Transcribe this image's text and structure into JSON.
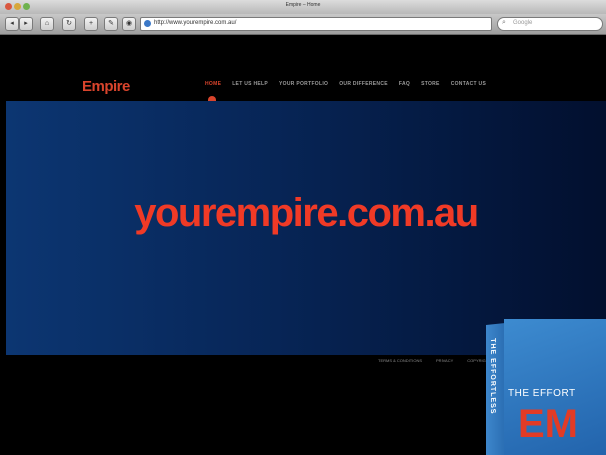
{
  "window": {
    "title": "Empire – Home",
    "controls": [
      "close",
      "minimize",
      "zoom"
    ]
  },
  "toolbar": {
    "back_icon": "back-arrow-icon",
    "forward_icon": "forward-arrow-icon",
    "buttons": [
      "home-icon",
      "reload-icon",
      "add-bookmark-icon",
      "edit-icon",
      "view-icon"
    ],
    "url": "http://www.yourempire.com.au/",
    "search_placeholder": "Google"
  },
  "site": {
    "logo": "Empire",
    "logo_sub": "",
    "nav": [
      "HOME",
      "LET US HELP",
      "YOUR PORTFOLIO",
      "OUR DIFFERENCE",
      "FAQ",
      "STORE",
      "CONTACT US"
    ],
    "hero_domain": "yourempire.com.au",
    "footer_links": [
      "TERMS & CONDITIONS",
      "PRIVACY",
      "COPYRIGHT"
    ]
  },
  "book": {
    "spine_text": "THE EFFORTLESS",
    "cover_title": "THE EFFORT",
    "cover_big": "EM"
  },
  "colors": {
    "accent": "#e8341f",
    "hero_dark": "#020f2e",
    "hero_light": "#0c3672",
    "book_blue": "#2b6fb4"
  }
}
